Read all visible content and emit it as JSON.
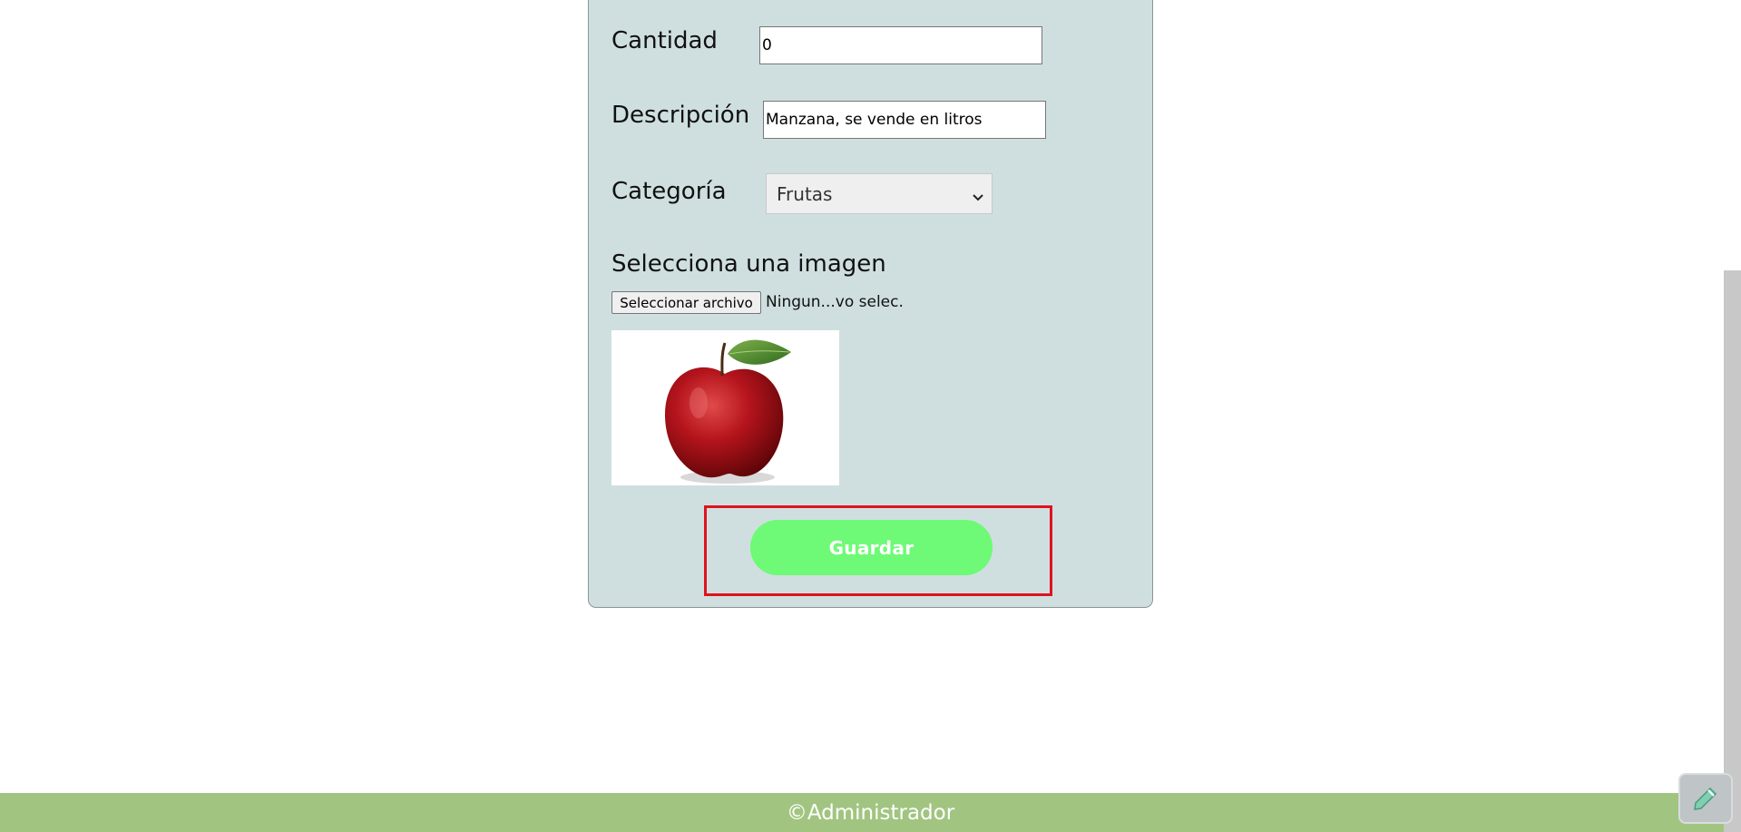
{
  "form": {
    "cantidad_label": "Cantidad",
    "cantidad_value": "0",
    "descripcion_label": "Descripción",
    "descripcion_value": "Manzana, se vende en litros",
    "categoria_label": "Categoría",
    "categoria_selected": "Frutas",
    "imagen_label": "Selecciona una imagen",
    "file_button_label": "Seleccionar archivo",
    "file_status": "Ningun...vo selec.",
    "save_label": "Guardar"
  },
  "footer": {
    "text": "©Administrador"
  },
  "colors": {
    "card_bg": "#cfdfe0",
    "save_button": "#6efa76",
    "footer_bg": "#a1c580",
    "highlight": "#e0121f"
  },
  "icons": {
    "select_chevron": "chevron-down-icon",
    "widget": "pencil-icon"
  }
}
